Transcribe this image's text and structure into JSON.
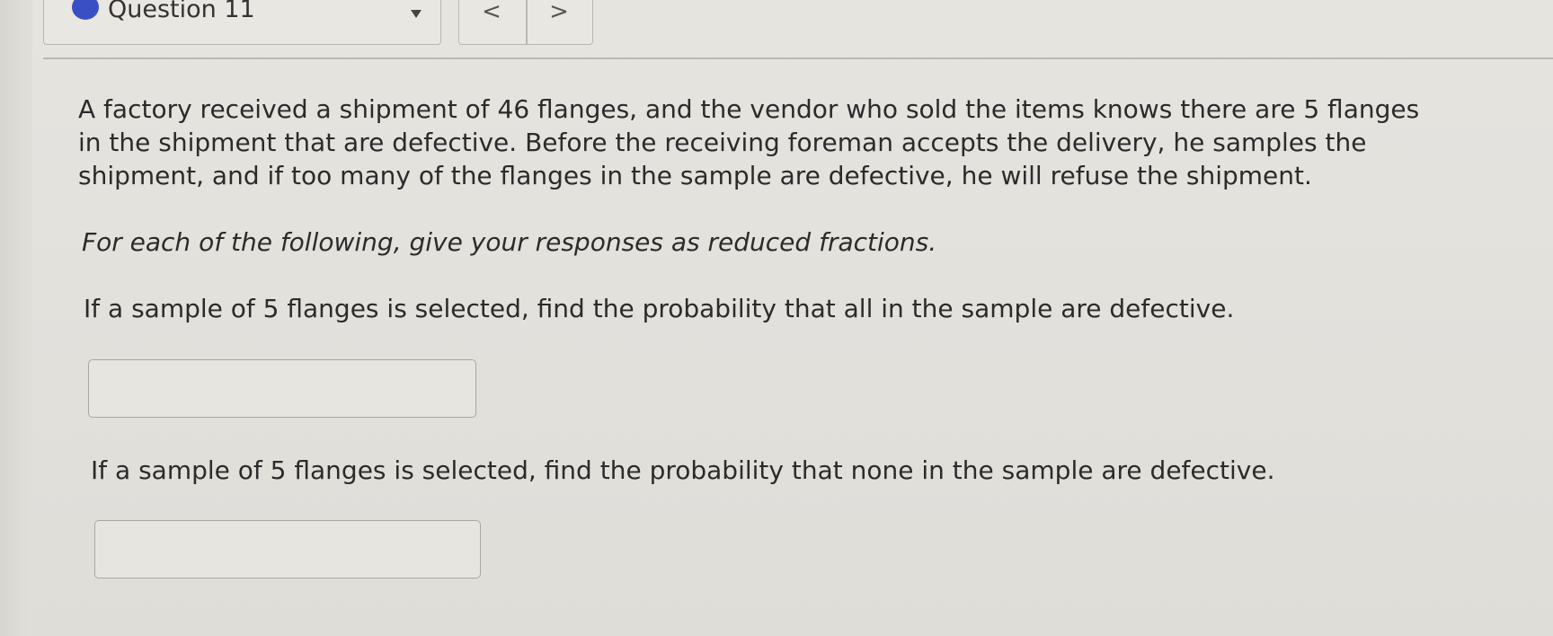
{
  "question_nav": {
    "label": "Question 11",
    "prev_label": "<",
    "next_label": ">"
  },
  "problem": {
    "intro_lines": [
      "A factory received a shipment of 46 flanges, and the vendor who sold the items knows there are 5 flanges",
      "in the shipment that are defective. Before the receiving foreman accepts the delivery, he samples the",
      "shipment, and if too many of the flanges in the sample are defective, he will refuse the shipment."
    ],
    "instruction": "For each of the following, give your responses as reduced fractions.",
    "part1": {
      "prompt": "If a sample of 5 flanges is selected, find the probability that all in the sample are defective.",
      "answer_value": ""
    },
    "part2": {
      "prompt": "If a sample of 5 flanges is selected, find the probability that none in the sample are defective.",
      "answer_value": ""
    }
  },
  "colors": {
    "indicator_dot": "#3b4fc4",
    "page_background": "#e3e1dc"
  }
}
